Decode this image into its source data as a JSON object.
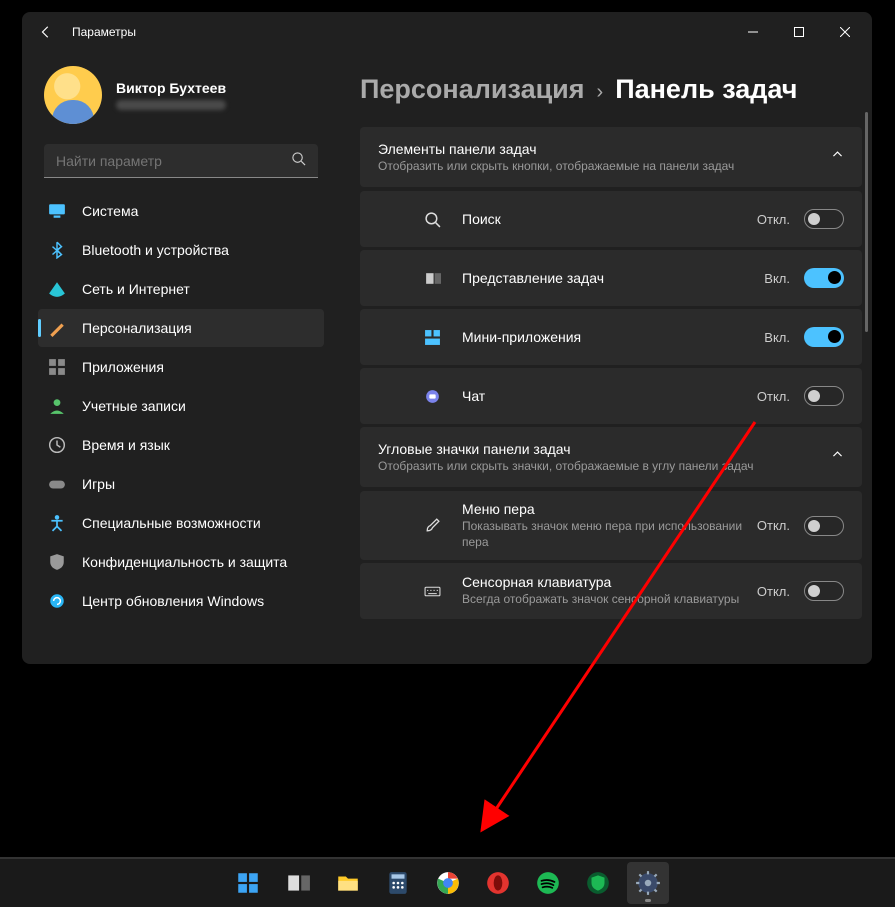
{
  "window": {
    "title": "Параметры",
    "user": {
      "name": "Виктор Бухтеев"
    },
    "search_placeholder": "Найти параметр"
  },
  "nav": {
    "items": [
      {
        "label": "Система",
        "icon": "display-icon",
        "color": "#4cc2ff"
      },
      {
        "label": "Bluetooth и устройства",
        "icon": "bluetooth-icon",
        "color": "#4cc2ff"
      },
      {
        "label": "Сеть и Интернет",
        "icon": "wifi-icon",
        "color": "#29c5d6"
      },
      {
        "label": "Персонализация",
        "icon": "brush-icon",
        "color": "#f0a050",
        "active": true
      },
      {
        "label": "Приложения",
        "icon": "apps-icon",
        "color": "#8a8a8a"
      },
      {
        "label": "Учетные записи",
        "icon": "account-icon",
        "color": "#57c46b"
      },
      {
        "label": "Время и язык",
        "icon": "clock-icon",
        "color": "#bbbbbb"
      },
      {
        "label": "Игры",
        "icon": "gamepad-icon",
        "color": "#8a8a8a"
      },
      {
        "label": "Специальные возможности",
        "icon": "accessibility-icon",
        "color": "#4cc2ff"
      },
      {
        "label": "Конфиденциальность и защита",
        "icon": "shield-icon",
        "color": "#9a9a9a"
      },
      {
        "label": "Центр обновления Windows",
        "icon": "update-icon",
        "color": "#29b6f6"
      }
    ]
  },
  "breadcrumb": {
    "parent": "Персонализация",
    "current": "Панель задач"
  },
  "sections": [
    {
      "title": "Элементы панели задач",
      "desc": "Отобразить или скрыть кнопки, отображаемые на панели задач",
      "items": [
        {
          "icon": "search-icon",
          "title": "Поиск",
          "state_label": "Откл.",
          "on": false
        },
        {
          "icon": "taskview-icon",
          "title": "Представление задач",
          "state_label": "Вкл.",
          "on": true
        },
        {
          "icon": "widgets-icon",
          "title": "Мини-приложения",
          "state_label": "Вкл.",
          "on": true
        },
        {
          "icon": "chat-icon",
          "title": "Чат",
          "state_label": "Откл.",
          "on": false
        }
      ]
    },
    {
      "title": "Угловые значки панели задач",
      "desc": "Отобразить или скрыть значки, отображаемые в углу панели задач",
      "items": [
        {
          "icon": "pen-icon",
          "title": "Меню пера",
          "desc": "Показывать значок меню пера при использовании пера",
          "state_label": "Откл.",
          "on": false
        },
        {
          "icon": "keyboard-icon",
          "title": "Сенсорная клавиатура",
          "desc": "Всегда отображать значок сенсорной клавиатуры",
          "state_label": "Откл.",
          "on": false
        }
      ]
    }
  ],
  "taskbar": {
    "items": [
      {
        "name": "start-icon"
      },
      {
        "name": "taskview-tb-icon"
      },
      {
        "name": "explorer-icon"
      },
      {
        "name": "calculator-icon"
      },
      {
        "name": "chrome-icon"
      },
      {
        "name": "opera-icon"
      },
      {
        "name": "spotify-icon"
      },
      {
        "name": "adguard-icon"
      },
      {
        "name": "settings-tb-icon",
        "active": true
      }
    ]
  }
}
